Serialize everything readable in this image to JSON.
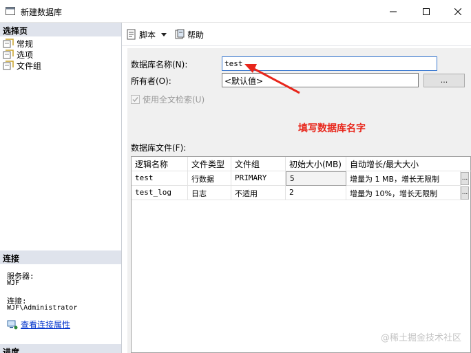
{
  "window": {
    "title": "新建数据库"
  },
  "left_pane": {
    "pages_header": "选择页",
    "pages": [
      {
        "label": "常规",
        "icon": "page-icon"
      },
      {
        "label": "选项",
        "icon": "page-icon"
      },
      {
        "label": "文件组",
        "icon": "page-icon"
      }
    ],
    "connection_header": "连接",
    "server_label": "服务器:",
    "server_value": "WJF",
    "connection_label": "连接:",
    "connection_value": "WJF\\Administrator",
    "view_connection_link": "查看连接属性",
    "progress_header": "进度"
  },
  "toolbar": {
    "script_label": "脚本",
    "help_label": "帮助"
  },
  "form": {
    "db_name_label": "数据库名称(N):",
    "db_name_value": "test",
    "owner_label": "所有者(O):",
    "owner_value": "<默认值>",
    "owner_browse": "...",
    "fulltext_label": "使用全文检索(U)",
    "files_label": "数据库文件(F):"
  },
  "files_table": {
    "columns": [
      "逻辑名称",
      "文件类型",
      "文件组",
      "初始大小(MB)",
      "自动增长/最大大小"
    ],
    "rows": [
      [
        "test",
        "行数据",
        "PRIMARY",
        "5",
        "增量为 1 MB，增长无限制"
      ],
      [
        "test_log",
        "日志",
        "不适用",
        "2",
        "增量为 10%，增长无限制"
      ]
    ],
    "row_button": "..."
  },
  "annotation": {
    "text": "填写数据库名字",
    "color": "#e8261b"
  },
  "watermark": "@稀土掘金技术社区",
  "colors": {
    "link": "#0033cc",
    "pane_header": "#dfe3ec",
    "focus_border": "#3b79d0"
  }
}
